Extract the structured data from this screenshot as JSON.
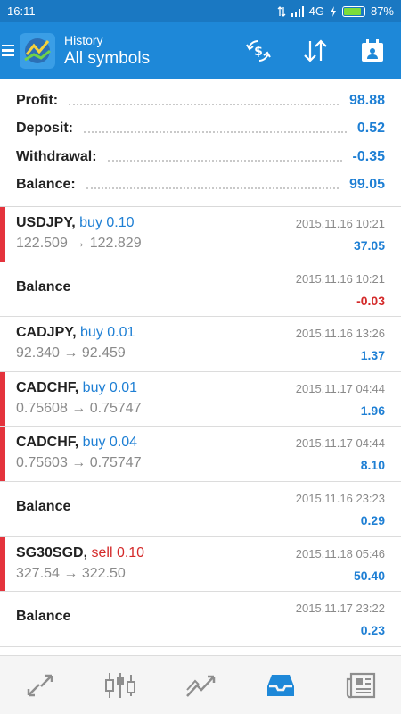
{
  "statusbar": {
    "time": "16:11",
    "signal": "4G",
    "battery_text": "87%",
    "battery_level": 0.87
  },
  "appbar": {
    "subtitle": "History",
    "title": "All symbols",
    "actions": [
      "currency-exchange-icon",
      "sort-icon",
      "calendar-icon"
    ]
  },
  "summary": [
    {
      "label": "Profit:",
      "value": "98.88"
    },
    {
      "label": "Deposit:",
      "value": "0.52"
    },
    {
      "label": "Withdrawal:",
      "value": "-0.35"
    },
    {
      "label": "Balance:",
      "value": "99.05"
    }
  ],
  "deals": [
    {
      "symbol": "USDJPY,",
      "side": "buy",
      "side_text": "buy 0.10",
      "open": "122.509",
      "close": "122.829",
      "arrow": "→",
      "time": "2015.11.16 10:21",
      "profit": "37.05",
      "profit_sign": "pos",
      "marked": true
    },
    {
      "symbol": "Balance",
      "side": "",
      "side_text": "",
      "open": "",
      "close": "",
      "arrow": "",
      "time": "2015.11.16 10:21",
      "profit": "-0.03",
      "profit_sign": "neg",
      "marked": false
    },
    {
      "symbol": "CADJPY,",
      "side": "buy",
      "side_text": "buy 0.01",
      "open": "92.340",
      "close": "92.459",
      "arrow": "→",
      "time": "2015.11.16 13:26",
      "profit": "1.37",
      "profit_sign": "pos",
      "marked": false
    },
    {
      "symbol": "CADCHF,",
      "side": "buy",
      "side_text": "buy 0.01",
      "open": "0.75608",
      "close": "0.75747",
      "arrow": "→",
      "time": "2015.11.17 04:44",
      "profit": "1.96",
      "profit_sign": "pos",
      "marked": true
    },
    {
      "symbol": "CADCHF,",
      "side": "buy",
      "side_text": "buy 0.04",
      "open": "0.75603",
      "close": "0.75747",
      "arrow": "→",
      "time": "2015.11.17 04:44",
      "profit": "8.10",
      "profit_sign": "pos",
      "marked": true
    },
    {
      "symbol": "Balance",
      "side": "",
      "side_text": "",
      "open": "",
      "close": "",
      "arrow": "",
      "time": "2015.11.16 23:23",
      "profit": "0.29",
      "profit_sign": "pos",
      "marked": false
    },
    {
      "symbol": "SG30SGD,",
      "side": "sell",
      "side_text": "sell 0.10",
      "open": "327.54",
      "close": "322.50",
      "arrow": "→",
      "time": "2015.11.18 05:46",
      "profit": "50.40",
      "profit_sign": "pos",
      "marked": true
    },
    {
      "symbol": "Balance",
      "side": "",
      "side_text": "",
      "open": "",
      "close": "",
      "arrow": "",
      "time": "2015.11.17 23:22",
      "profit": "0.23",
      "profit_sign": "pos",
      "marked": false
    }
  ],
  "bottom_tabs": [
    {
      "icon": "quotes-icon",
      "active": false
    },
    {
      "icon": "chart-icon",
      "active": false
    },
    {
      "icon": "trade-icon",
      "active": false
    },
    {
      "icon": "history-icon",
      "active": true
    },
    {
      "icon": "news-icon",
      "active": false
    }
  ],
  "colors": {
    "appbar": "#1e88d8",
    "statusbar": "#1a78c2",
    "accent_blue": "#1e7fd4",
    "loss_red": "#d42a2a",
    "marker_red": "#e4333c",
    "tab_active": "#1e88d8",
    "tab_inactive": "#8e8e8e"
  }
}
